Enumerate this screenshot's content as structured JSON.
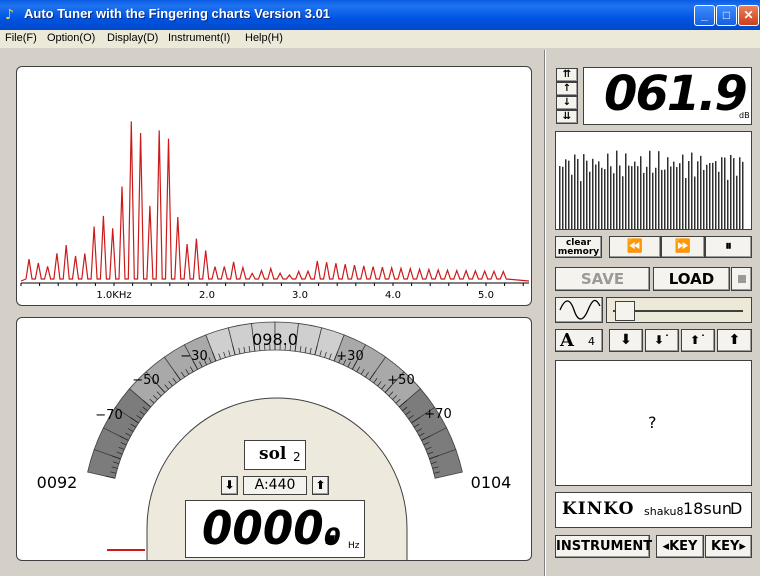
{
  "window": {
    "title": "Auto Tuner with the Fingering charts  Version 3.01",
    "minimize": "_",
    "maximize": "□",
    "close": "✕"
  },
  "menu": [
    "File(F)",
    "Option(O)",
    "Display(D)",
    "Instrument(I)",
    "Help(H)"
  ],
  "spectrum": {
    "tick_labels": [
      "1.0KHz",
      "2.0",
      "3.0",
      "4.0",
      "5.0"
    ],
    "line_color": "#cc1a1a"
  },
  "meter": {
    "top_value": "098.0",
    "left_value": "0092",
    "right_value": "0104",
    "cents_labels": [
      "−70",
      "−50",
      "−30",
      "+30",
      "+50",
      "+70"
    ],
    "note_name": "sol",
    "note_octave": "2",
    "pitch_ref": "A:440",
    "freq_main": "0000.",
    "freq_decimal": "0",
    "freq_unit": "Hz"
  },
  "level": {
    "value": "061.9",
    "unit": "dB"
  },
  "history": {
    "clear_label": "clear memory"
  },
  "file_buttons": {
    "save": "SAVE",
    "load": "LOAD"
  },
  "transpose": {
    "note": "A",
    "number": "4"
  },
  "fingering": {
    "text": "?"
  },
  "instrument": {
    "name": "KINKO",
    "type": "shaku8",
    "size": "18sun",
    "key": "D"
  },
  "bottom_buttons": {
    "instrument": "INSTRUMENT",
    "key_down": "KEY",
    "key_up": "KEY"
  },
  "colors": {
    "titlebar": "#0055e5",
    "window_bg": "#d4d0c8",
    "spectrum_line": "#cc1a1a"
  }
}
